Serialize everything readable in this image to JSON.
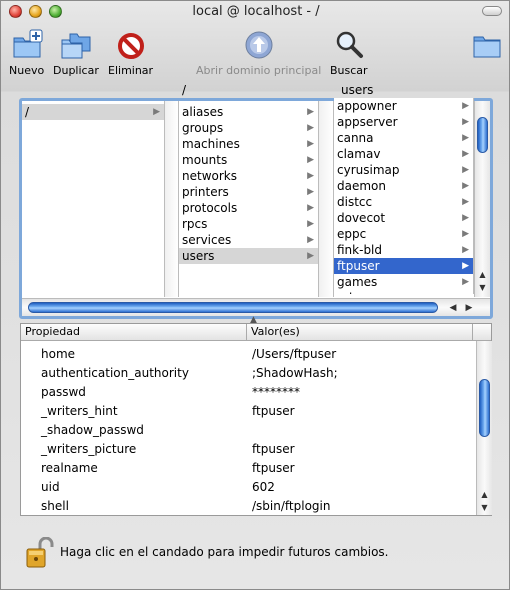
{
  "window": {
    "title": "local @ localhost - /"
  },
  "toolbar": {
    "nuevo": "Nuevo",
    "duplicar": "Duplicar",
    "eliminar": "Eliminar",
    "abrir": "Abrir dominio principal",
    "buscar": "Buscar"
  },
  "browser": {
    "col1_header": "",
    "col2_header": "/",
    "col3_header": "users",
    "col1": [
      {
        "label": "/"
      }
    ],
    "col2": [
      {
        "label": "aliases"
      },
      {
        "label": "groups"
      },
      {
        "label": "machines"
      },
      {
        "label": "mounts"
      },
      {
        "label": "networks"
      },
      {
        "label": "printers"
      },
      {
        "label": "protocols"
      },
      {
        "label": "rpcs"
      },
      {
        "label": "services"
      },
      {
        "label": "users"
      }
    ],
    "col3": [
      {
        "label": "appowner"
      },
      {
        "label": "appserver"
      },
      {
        "label": "canna"
      },
      {
        "label": "clamav"
      },
      {
        "label": "cyrusimap"
      },
      {
        "label": "daemon"
      },
      {
        "label": "distcc"
      },
      {
        "label": "dovecot"
      },
      {
        "label": "eppc"
      },
      {
        "label": "fink-bld"
      },
      {
        "label": "ftpuser"
      },
      {
        "label": "games"
      },
      {
        "label": "gdm"
      }
    ],
    "selected": {
      "col1": "/",
      "col2": "users",
      "col3": "ftpuser"
    }
  },
  "properties": {
    "col_property": "Propiedad",
    "col_value": "Valor(es)",
    "rows": [
      {
        "k": "home",
        "v": "/Users/ftpuser"
      },
      {
        "k": "authentication_authority",
        "v": ";ShadowHash;"
      },
      {
        "k": "passwd",
        "v": "********"
      },
      {
        "k": "_writers_hint",
        "v": "ftpuser"
      },
      {
        "k": "_shadow_passwd",
        "v": ""
      },
      {
        "k": "_writers_picture",
        "v": "ftpuser"
      },
      {
        "k": "realname",
        "v": "ftpuser"
      },
      {
        "k": "uid",
        "v": "602"
      },
      {
        "k": "shell",
        "v": "/sbin/ftplogin"
      }
    ]
  },
  "lock": {
    "message": "Haga clic en el candado para impedir futuros cambios."
  },
  "colors": {
    "selection": "#3366cc",
    "scroll": "#4a8ce6"
  },
  "icons": {
    "nuevo": "new-folder-icon",
    "duplicar": "duplicate-icon",
    "eliminar": "delete-icon",
    "abrir": "parent-domain-icon",
    "buscar": "search-icon",
    "lock": "lock-icon"
  }
}
